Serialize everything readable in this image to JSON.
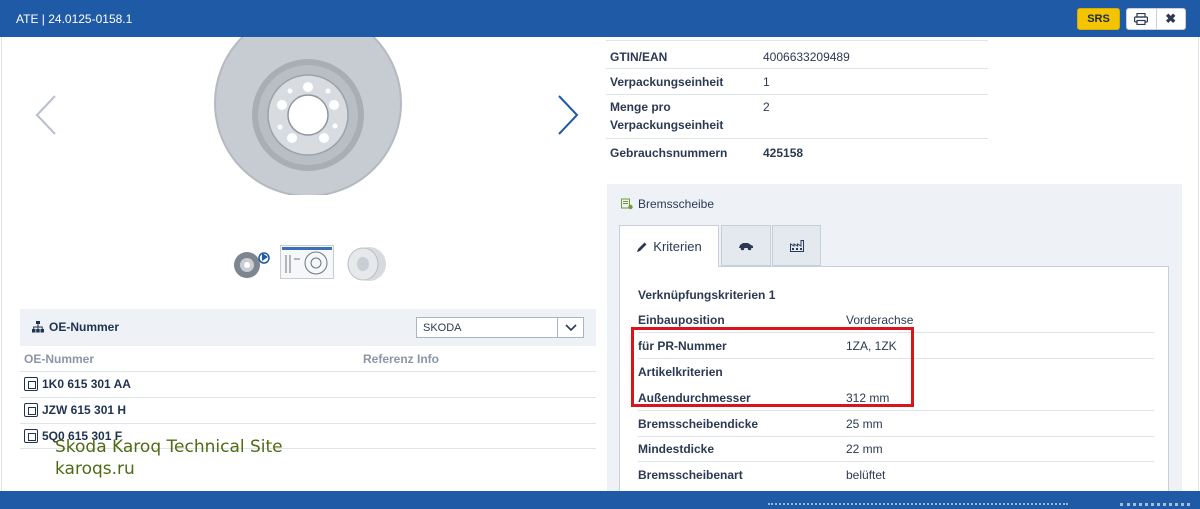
{
  "window": {
    "title": "ATE | 24.0125-0158.1",
    "srs_label": "SRS",
    "print_icon": "print-icon",
    "close_icon": "close-icon",
    "close_glyph": "✖"
  },
  "colors": {
    "titlebar": "#1f5aa6",
    "srs_button": "#f5c400",
    "highlight": "#d9141e"
  },
  "oe": {
    "header_title": "OE-Nummer",
    "brand_select": "SKODA",
    "col_oe": "OE-Nummer",
    "col_ref": "Referenz Info",
    "numbers": [
      "1K0 615 301 AA",
      "JZW 615 301 H",
      "5Q0 615 301 F"
    ]
  },
  "watermark": {
    "line1": "Skoda Karoq Technical Site",
    "line2": "karoqs.ru"
  },
  "specs": [
    {
      "key": "GTIN/EAN",
      "value": "4006633209489",
      "bold": false
    },
    {
      "key": "Verpackungseinheit",
      "value": "1",
      "bold": false
    },
    {
      "key": "Menge pro Verpackungseinheit",
      "value": "2",
      "bold": false
    },
    {
      "key": "Gebrauchsnummern",
      "value": "425158",
      "bold": true
    }
  ],
  "brems": {
    "title": "Bremsscheibe",
    "tabs": [
      {
        "label": "Kriterien",
        "icon": "pencil-icon"
      },
      {
        "label": "",
        "icon": "car-icon"
      },
      {
        "label": "",
        "icon": "factory-icon"
      }
    ],
    "group1": "Verknüpfungskriterien 1",
    "group2": "Artikelkriterien",
    "rows_top": [
      {
        "key": "Einbauposition",
        "value": "Vorderachse"
      },
      {
        "key": "für PR-Nummer",
        "value": "1ZA, 1ZK"
      }
    ],
    "rows_bottom": [
      {
        "key": "Außendurchmesser",
        "value": "312 mm"
      },
      {
        "key": "Bremsscheibendicke",
        "value": "25 mm"
      },
      {
        "key": "Mindestdicke",
        "value": "22 mm"
      },
      {
        "key": "Bremsscheibenart",
        "value": "belüftet"
      }
    ]
  }
}
